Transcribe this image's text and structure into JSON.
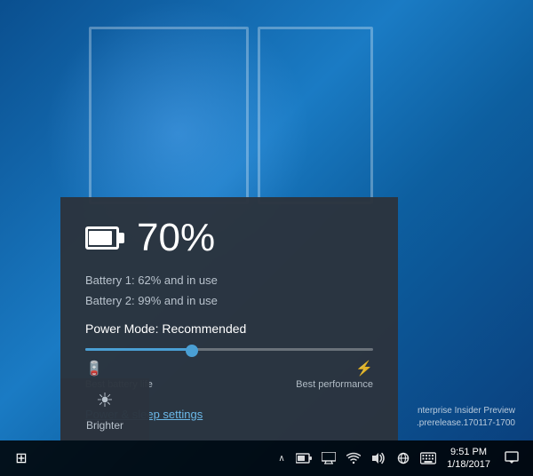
{
  "desktop": {
    "background_color": "#0a5fa3"
  },
  "battery_panel": {
    "percentage": "70%",
    "battery1_text": "Battery 1: 62% and in use",
    "battery2_text": "Battery 2: 99% and in use",
    "power_mode_label": "Power Mode: Recommended",
    "slider_position_pct": 38,
    "label_left_text": "Best battery life",
    "label_right_text": "Best performance",
    "power_sleep_link": "Power & sleep settings"
  },
  "quick_action": {
    "label": "Brighter"
  },
  "taskbar": {
    "time": "9:51 PM",
    "date": "1/18/2017",
    "chevron_label": "^",
    "action_center_label": "💬"
  },
  "watermark": {
    "line1": "nterprise Insider Preview",
    "line2": ".prerelease.170117-1700"
  },
  "icons": {
    "battery_small": "🔋",
    "monitor": "🖥",
    "wifi": "📶",
    "sound": "🔊",
    "keyboard": "⌨",
    "action_center": "💬",
    "start": "⊞"
  }
}
